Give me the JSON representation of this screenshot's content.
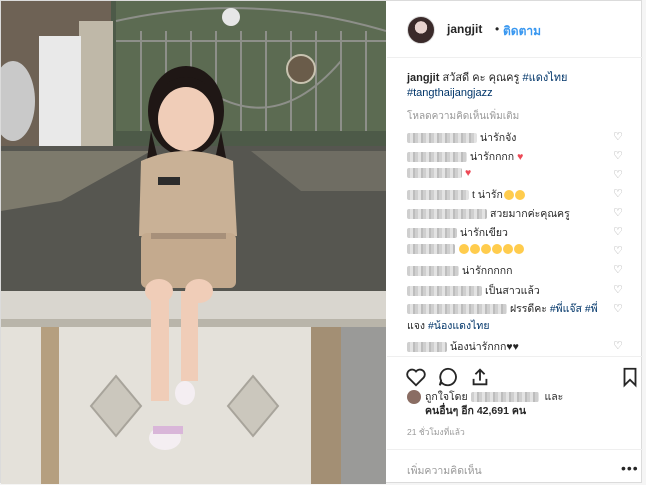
{
  "post": {
    "username": "jangjit",
    "separator": "•",
    "follow_label": "ติดตาม",
    "caption_user": "jangjit",
    "caption_text": "สวัสดี คะ คุณครู",
    "caption_tag1": "#แดงไทย",
    "caption_tag2": "#tangthaijangjazz",
    "load_more": "โหลดความคิดเห็นเพิ่มเติม"
  },
  "comments": [
    {
      "text": "น่ารักจัง"
    },
    {
      "text": "น่ารักกกก"
    },
    {
      "text": ""
    },
    {
      "text": "t น่ารัก"
    },
    {
      "text": "สวยมากค่ะคุณครู"
    },
    {
      "text": "น่ารักเขียว"
    },
    {
      "text": ""
    },
    {
      "text": "น่ารักกกกก"
    },
    {
      "text": "เป็นสาวแล้ว"
    },
    {
      "text": "ฝรรดีคะ",
      "tag1": "#พี่แจ๊ส",
      "tag2": "#พี่"
    },
    {
      "text": "แจง",
      "tag1": "#น้องแดงไทย"
    },
    {
      "text": "น้องน่ารักกก"
    }
  ],
  "likes": {
    "prefix": "ถูกใจโดย",
    "and": "และ",
    "others_label": "คนอื่นๆ อีก 42,691 คน"
  },
  "timestamp": "21 ชั่วโมงที่แล้ว",
  "add_comment_placeholder": "เพิ่มความคิดเห็น",
  "more_icon": "•••",
  "colors": {
    "link": "#3897f0",
    "tag": "#003569",
    "heart": "#ed4956"
  }
}
